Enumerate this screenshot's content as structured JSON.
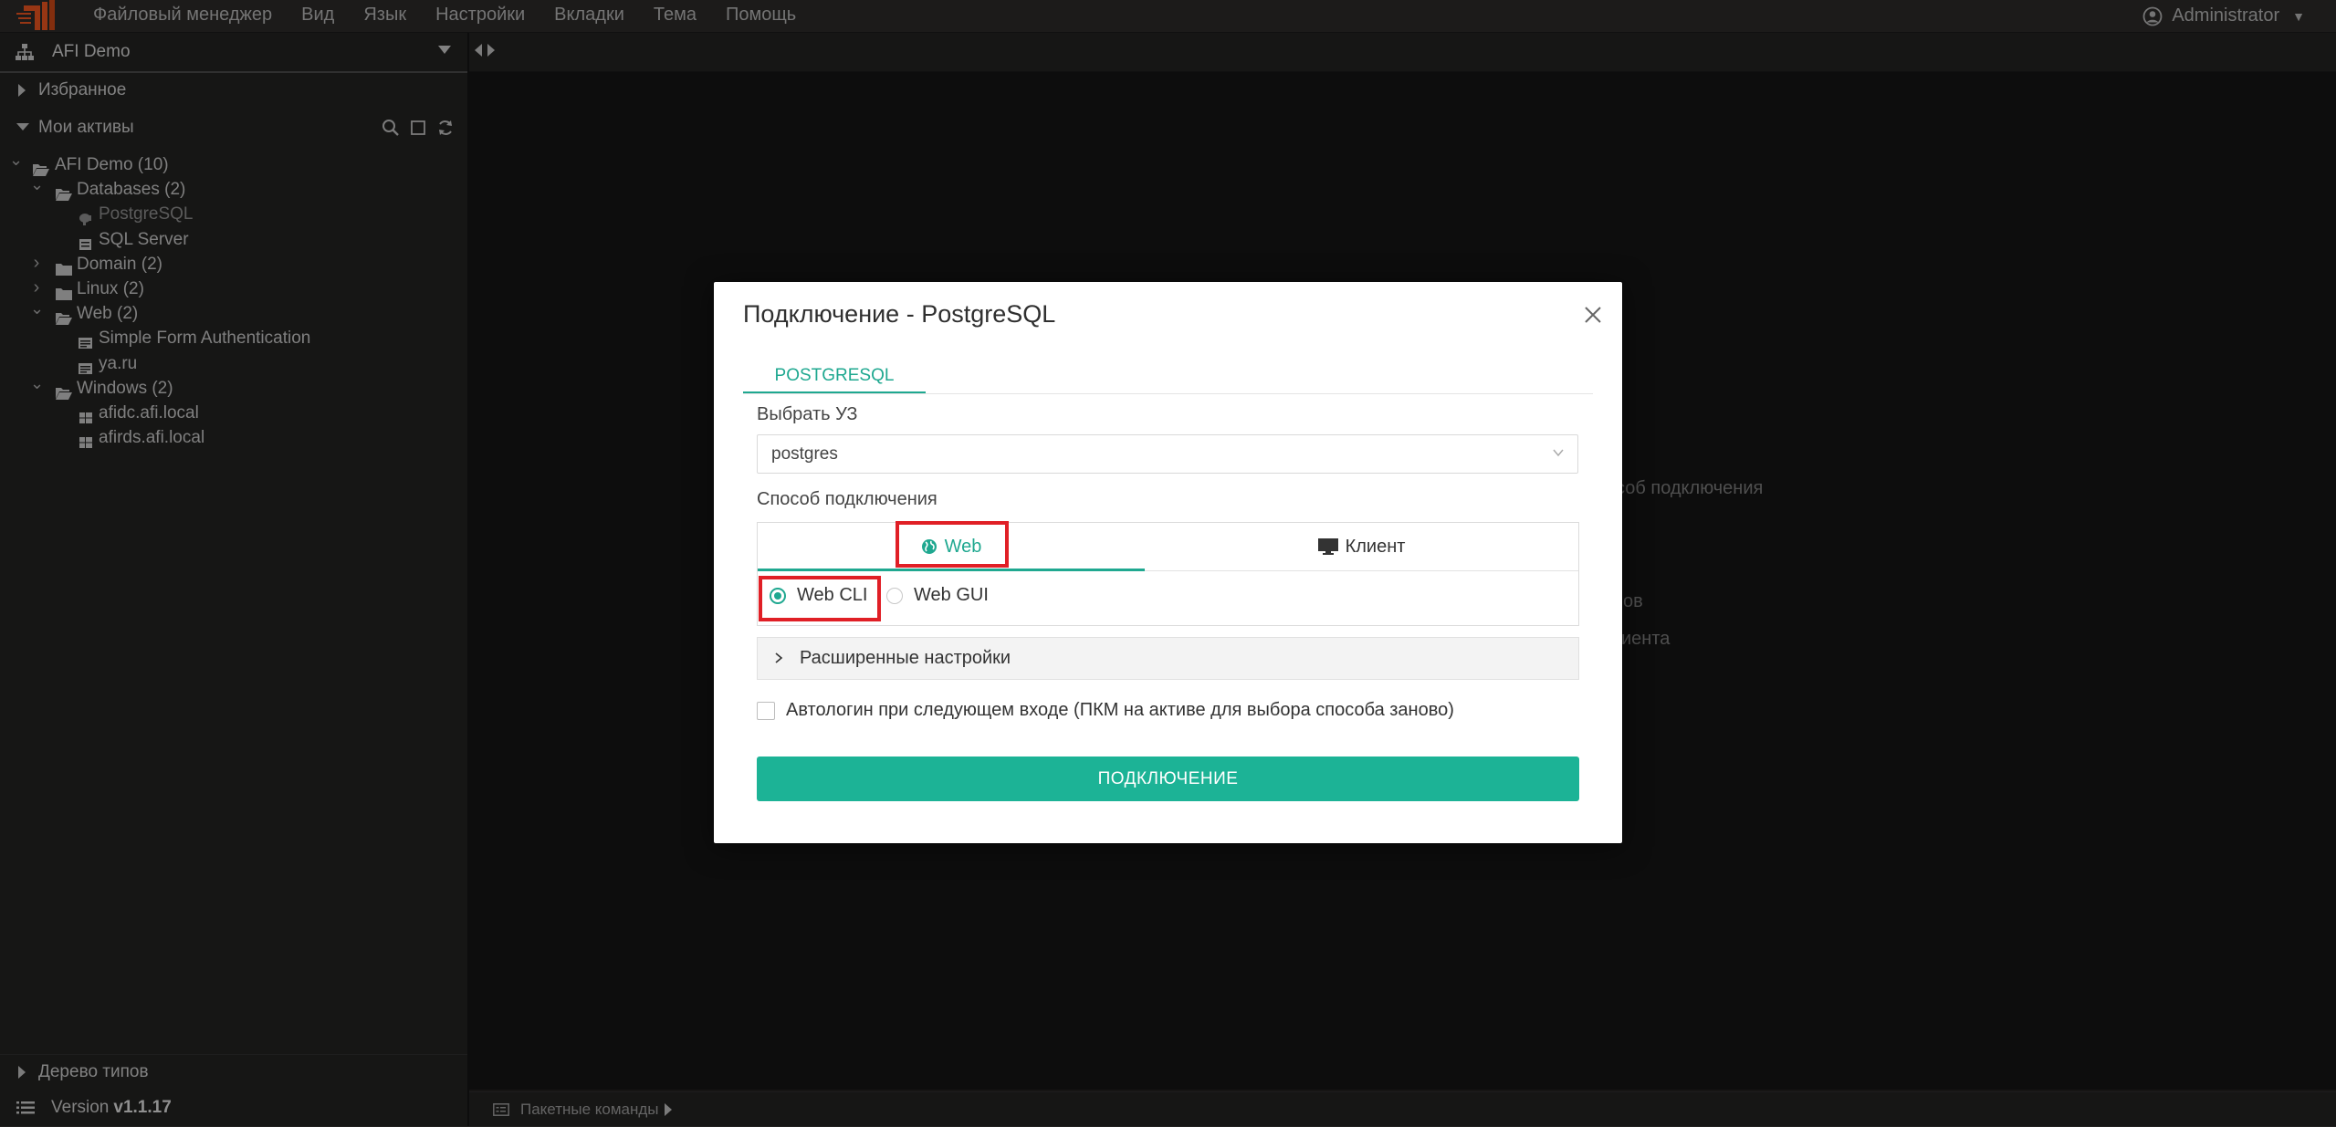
{
  "menubar": {
    "items": [
      "Файловый менеджер",
      "Вид",
      "Язык",
      "Настройки",
      "Вкладки",
      "Тема",
      "Помощь"
    ],
    "user": "Administrator"
  },
  "sidebar": {
    "workspace": "AFI Demo",
    "favorites_label": "Избранное",
    "assets_label": "Мои активы",
    "tree": [
      {
        "label": "AFI Demo (10)",
        "level": 0,
        "chevron": "down",
        "icon": "folder-open-icon"
      },
      {
        "label": "Databases (2)",
        "level": 1,
        "chevron": "down",
        "icon": "folder-open-icon"
      },
      {
        "label": "PostgreSQL",
        "level": 2,
        "chevron": "",
        "icon": "postgres-icon",
        "dim": true
      },
      {
        "label": "SQL Server",
        "level": 2,
        "chevron": "",
        "icon": "database-icon"
      },
      {
        "label": "Domain (2)",
        "level": 1,
        "chevron": "right",
        "icon": "folder-icon"
      },
      {
        "label": "Linux (2)",
        "level": 1,
        "chevron": "right",
        "icon": "folder-icon"
      },
      {
        "label": "Web (2)",
        "level": 1,
        "chevron": "down",
        "icon": "folder-open-icon"
      },
      {
        "label": "Simple Form Authentication",
        "level": 2,
        "chevron": "",
        "icon": "web-form-icon"
      },
      {
        "label": "ya.ru",
        "level": 2,
        "chevron": "",
        "icon": "web-form-icon"
      },
      {
        "label": "Windows (2)",
        "level": 1,
        "chevron": "down",
        "icon": "folder-open-icon"
      },
      {
        "label": "afidc.afi.local",
        "level": 2,
        "chevron": "",
        "icon": "windows-icon"
      },
      {
        "label": "afirds.afi.local",
        "level": 2,
        "chevron": "",
        "icon": "windows-icon"
      }
    ],
    "types_label": "Дерево типов",
    "version_label": "Version",
    "version_number": "v1.1.17"
  },
  "background_hints": [
    "соб подключения",
    "ов",
    "иента"
  ],
  "bottombar": {
    "label": "Пакетные команды"
  },
  "modal": {
    "title": "Подключение - PostgreSQL",
    "tab": "POSTGRESQL",
    "account_label": "Выбрать УЗ",
    "account_value": "postgres",
    "method_label": "Способ подключения",
    "method_tabs": [
      "Web",
      "Клиент"
    ],
    "active_method": "Web",
    "radios": [
      "Web CLI",
      "Web GUI"
    ],
    "selected_radio": "Web CLI",
    "advanced_label": "Расширенные настройки",
    "autologin_label": "Автологин при следующем входе (ПКМ на активе для выбора способа заново)",
    "autologin_checked": false,
    "connect_label": "ПОДКЛЮЧЕНИЕ"
  },
  "colors": {
    "accent": "#1fa890",
    "button": "#1cb396",
    "highlight": "#e01f26",
    "logo": "#e8541f"
  }
}
